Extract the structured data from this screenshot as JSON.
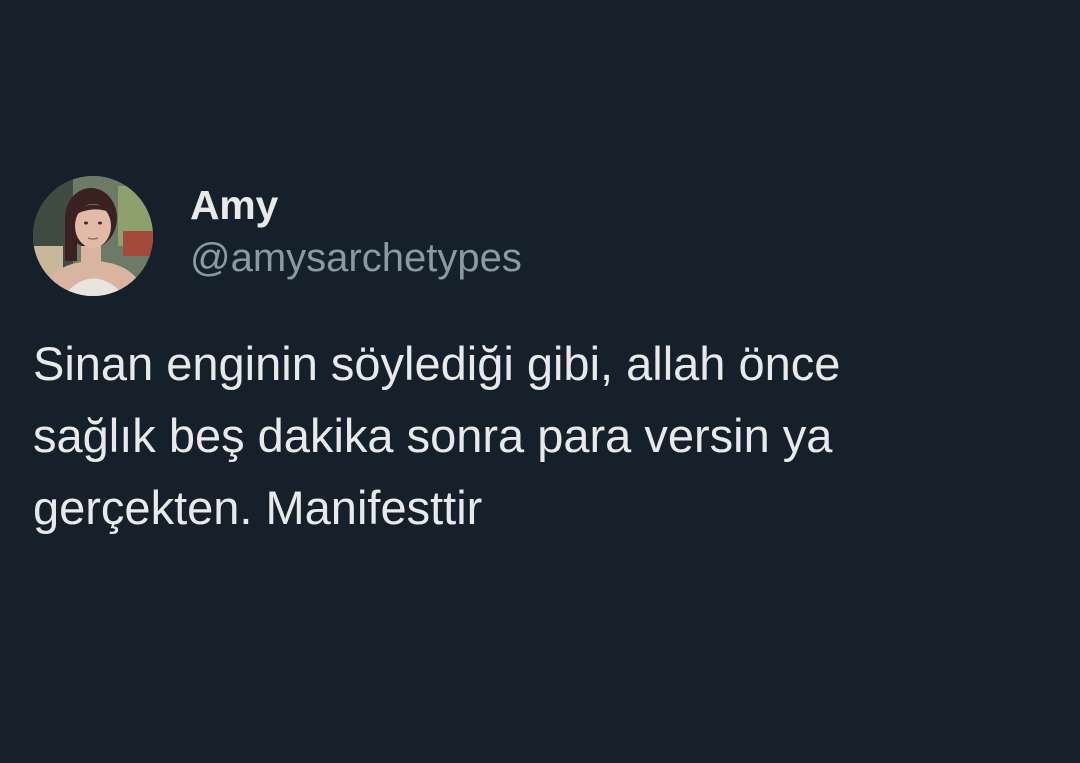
{
  "tweet": {
    "author": {
      "display_name": "Amy",
      "handle": "@amysarchetypes",
      "avatar_icon": "profile-photo"
    },
    "text": "Sinan enginin söylediği gibi, allah önce\nsağlık beş dakika sonra para versin ya\ngerçekten. Manifesttir"
  },
  "colors": {
    "background": "#16202a",
    "primary_text": "#e7e9ea",
    "secondary_text": "#8b98a5"
  }
}
